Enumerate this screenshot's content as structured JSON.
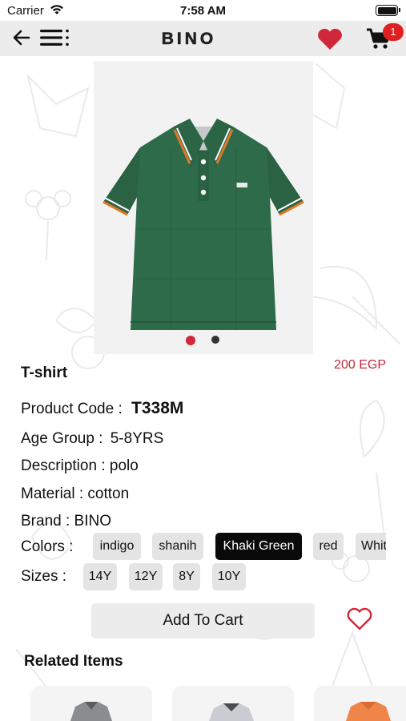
{
  "status_bar": {
    "carrier": "Carrier",
    "time": "7:58 AM"
  },
  "header": {
    "logo_text": "BINO",
    "cart_count": "1"
  },
  "product": {
    "gallery": {
      "image_count": 2,
      "active_index": 0
    },
    "name": "T-shirt",
    "price": "200 EGP",
    "code_label": "Product Code :",
    "code_value": "T338M",
    "age_label": "Age Group :",
    "age_value": "5-8YRS",
    "description": "Description : polo",
    "material": "Material : cotton",
    "brand": "Brand : BINO",
    "colors_label": "Colors :",
    "colors": [
      "indigo",
      "shanih",
      "Khaki Green",
      "red",
      "White"
    ],
    "selected_color": "Khaki Green",
    "sizes_label": "Sizes :",
    "sizes": [
      "14Y",
      "12Y",
      "8Y",
      "10Y"
    ],
    "add_to_cart_label": "Add To Cart"
  },
  "related": {
    "title": "Related Items"
  },
  "colors": {
    "accent_red": "#d0283a",
    "shirt_green": "#2e6b4a",
    "chip_bg": "#e4e4e4",
    "selected_chip_bg": "#0a0a0a",
    "header_bg": "#ececec"
  }
}
